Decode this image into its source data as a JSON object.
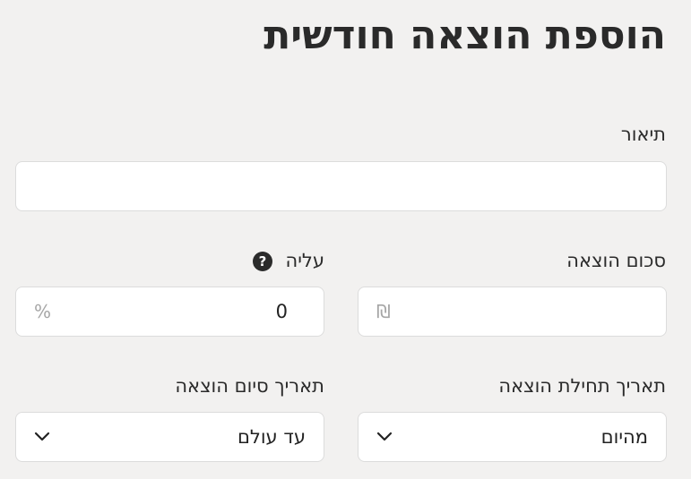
{
  "page": {
    "title": "הוספת הוצאה חודשית"
  },
  "description": {
    "label": "תיאור",
    "value": "",
    "placeholder": ""
  },
  "amount": {
    "label": "סכום הוצאה",
    "value": "",
    "currency_symbol": "₪"
  },
  "increase": {
    "label": "עליה",
    "value": "0",
    "unit_symbol": "%",
    "help_icon": "question-circle-icon",
    "help_glyph": "?"
  },
  "start_date": {
    "label": "תאריך תחילת הוצאה",
    "selected": "מהיום",
    "icon": "chevron-down-icon"
  },
  "end_date": {
    "label": "תאריך סיום הוצאה",
    "selected": "עד עולם",
    "icon": "chevron-down-icon"
  },
  "colors": {
    "background": "#f2f1f0",
    "field_background": "#ffffff",
    "border": "#dcdcdc",
    "text": "#2a2a2a",
    "muted": "#a6a6a6"
  }
}
